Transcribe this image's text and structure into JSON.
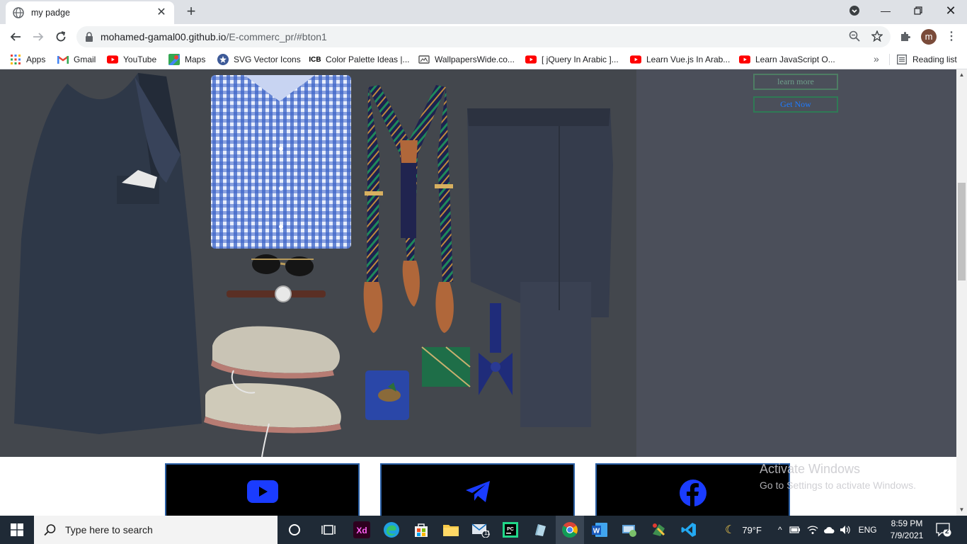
{
  "browser": {
    "tab_title": "my padge",
    "url_host": "mohamed-gamal00.github.io",
    "url_path": "/E-commerc_pr/#bton1",
    "profile_initial": "m"
  },
  "bookmarks": [
    {
      "label": "Apps",
      "icon": "apps-grid-icon"
    },
    {
      "label": "Gmail",
      "icon": "gmail-icon"
    },
    {
      "label": "YouTube",
      "icon": "youtube-icon"
    },
    {
      "label": "Maps",
      "icon": "maps-icon"
    },
    {
      "label": "SVG Vector Icons",
      "icon": "svg-vector-icon"
    },
    {
      "label": "Color Palette Ideas |...",
      "icon": "icb-icon"
    },
    {
      "label": "WallpapersWide.co...",
      "icon": "wallpaperswide-icon"
    },
    {
      "label": "[ jQuery In Arabic ]...",
      "icon": "youtube-icon"
    },
    {
      "label": "Learn Vue.js In Arab...",
      "icon": "youtube-icon"
    },
    {
      "label": "Learn JavaScript O...",
      "icon": "youtube-icon"
    }
  ],
  "reading_list": "Reading list",
  "page": {
    "learn_more": "learn more",
    "get_now": "Get Now",
    "social": [
      "youtube-icon",
      "telegram-icon",
      "facebook-icon"
    ]
  },
  "watermark": {
    "line1": "Activate Windows",
    "line2": "Go to Settings to activate Windows."
  },
  "taskbar": {
    "search_placeholder": "Type here to search",
    "mail_badge": "11",
    "weather": "79°F",
    "language": "ENG",
    "time": "8:59 PM",
    "date": "7/9/2021",
    "notifications": "2"
  },
  "colors": {
    "hero_bg": "#4b4f5a",
    "get_now_text": "#1f7bff",
    "social_bg": "#000000",
    "social_icon": "#1a3cff"
  }
}
